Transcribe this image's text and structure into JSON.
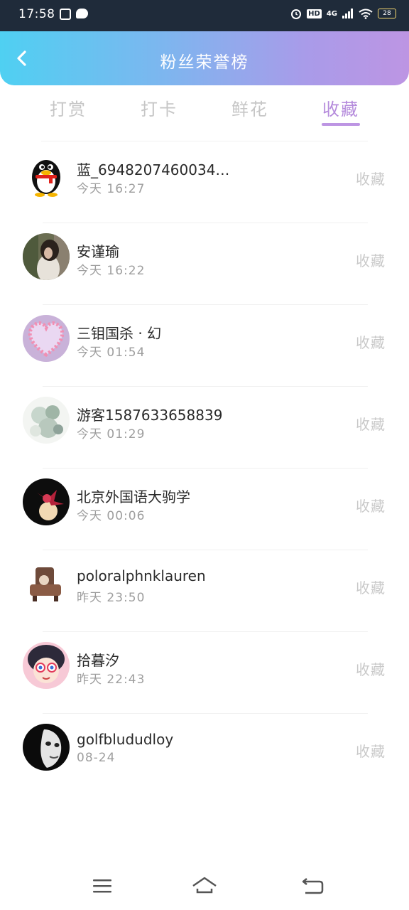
{
  "status_bar": {
    "time": "17:58",
    "network": "4G",
    "hd": "HD",
    "battery": "28"
  },
  "header": {
    "title": "粉丝荣誉榜"
  },
  "tabs": [
    {
      "label": "打赏",
      "active": false
    },
    {
      "label": "打卡",
      "active": false
    },
    {
      "label": "鲜花",
      "active": false
    },
    {
      "label": "收藏",
      "active": true
    }
  ],
  "items": [
    {
      "name": "蓝_6948207460034…",
      "time": "今天  16:27",
      "action": "收藏",
      "avatar": "penguin-avatar"
    },
    {
      "name": "安谨瑜",
      "time": "今天  16:22",
      "action": "收藏",
      "avatar": "girl-photo-avatar"
    },
    {
      "name": "三钼国杀 · 幻",
      "time": "今天  01:54",
      "action": "收藏",
      "avatar": "heart-frame-avatar"
    },
    {
      "name": "游客1587633658839",
      "time": "今天  01:29",
      "action": "收藏",
      "avatar": "flowers-avatar"
    },
    {
      "name": "北京外国语大驹学",
      "time": "今天  00:06",
      "action": "收藏",
      "avatar": "red-flower-avatar"
    },
    {
      "name": "poloralphnklauren",
      "time": "昨天  23:50",
      "action": "收藏",
      "avatar": "sofa-avatar"
    },
    {
      "name": "拾暮汐",
      "time": "昨天  22:43",
      "action": "收藏",
      "avatar": "cartoon-girl-avatar"
    },
    {
      "name": "golfblududloy",
      "time": "08-24",
      "action": "收藏",
      "avatar": "mask-avatar"
    }
  ],
  "colors": {
    "accent": "#bd95e3",
    "header_start": "#4fd0f2",
    "header_end": "#bd95e3"
  }
}
